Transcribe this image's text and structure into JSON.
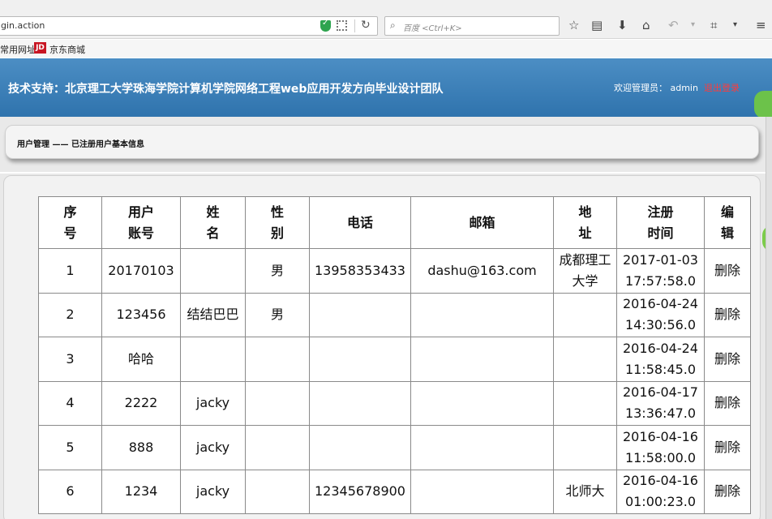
{
  "browser": {
    "url": "gin.action",
    "search_placeholder": "百度 <Ctrl+K>",
    "bookmarks": [
      "常用网址",
      "京东商城"
    ],
    "jd_badge": "JD"
  },
  "header": {
    "title": "技术支持：北京理工大学珠海学院计算机学院网络工程web应用开发方向毕业设计团队",
    "welcome": "欢迎管理员：  admin",
    "logout": "退出登录"
  },
  "breadcrumb": "用户管理 —— 已注册用户基本信息",
  "table": {
    "headers": [
      [
        "序",
        "号"
      ],
      [
        "用户",
        "账号"
      ],
      [
        "姓",
        "名"
      ],
      [
        "性",
        "别"
      ],
      [
        "电话"
      ],
      [
        "邮箱"
      ],
      [
        "地",
        "址"
      ],
      [
        "注册",
        "时间"
      ],
      [
        "编",
        "辑"
      ]
    ],
    "rows": [
      {
        "seq": "1",
        "account": "20170103",
        "name": "",
        "gender": "男",
        "phone": "13958353433",
        "email": "dashu@163.com",
        "address": "成都理工大学",
        "time": "2017-01-03 17:57:58.0",
        "edit": "删除"
      },
      {
        "seq": "2",
        "account": "123456",
        "name": "结结巴巴",
        "gender": "男",
        "phone": "",
        "email": "",
        "address": "",
        "time": "2016-04-24 14:30:56.0",
        "edit": "删除"
      },
      {
        "seq": "3",
        "account": "哈哈",
        "name": "",
        "gender": "",
        "phone": "",
        "email": "",
        "address": "",
        "time": "2016-04-24 11:58:45.0",
        "edit": "删除"
      },
      {
        "seq": "4",
        "account": "2222",
        "name": "jacky",
        "gender": "",
        "phone": "",
        "email": "",
        "address": "",
        "time": "2016-04-17 13:36:47.0",
        "edit": "删除"
      },
      {
        "seq": "5",
        "account": "888",
        "name": "jacky",
        "gender": "",
        "phone": "",
        "email": "",
        "address": "",
        "time": "2016-04-16 11:58:00.0",
        "edit": "删除"
      },
      {
        "seq": "6",
        "account": "1234",
        "name": "jacky",
        "gender": "",
        "phone": "12345678900",
        "email": "",
        "address": "北师大",
        "time": "2016-04-16 01:00:23.0",
        "edit": "删除"
      }
    ]
  }
}
